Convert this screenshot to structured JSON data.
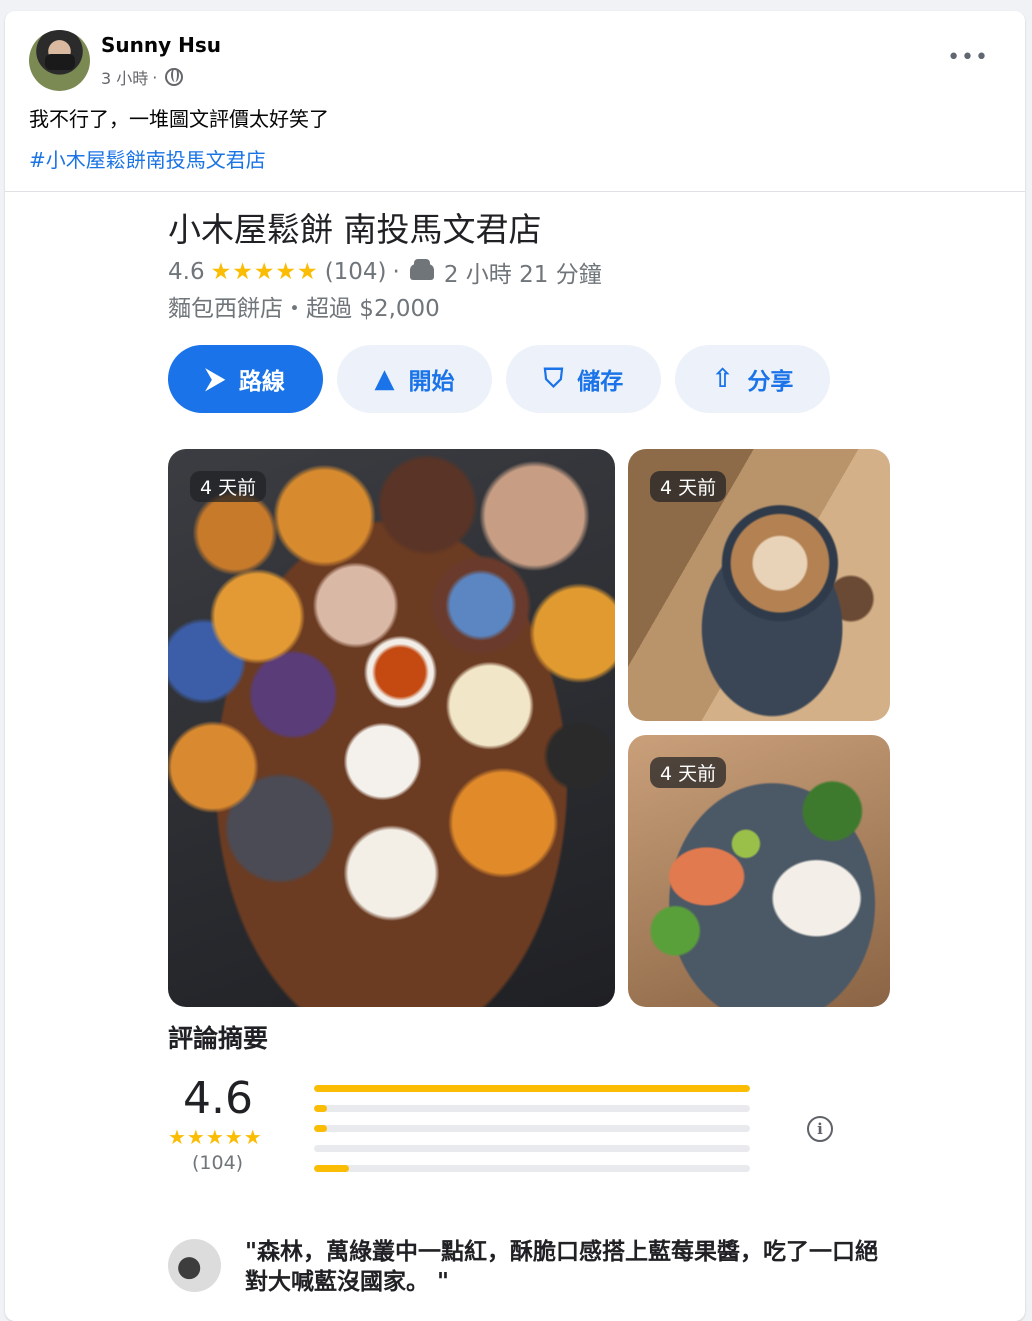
{
  "post": {
    "author": "Sunny Hsu",
    "time": "3 小時",
    "visibility_icon": "globe-icon",
    "text": "我不行了，一堆圖文評價太好笑了",
    "hashtag": "#小木屋鬆餅南投馬文君店"
  },
  "place": {
    "name": "小木屋鬆餅 南投馬文君店",
    "rating": "4.6",
    "stars": "★★★★★",
    "review_count": "(104)",
    "separator": "·",
    "drive_time": "2 小時 21 分鐘",
    "category_price": "麵包西餅店・超過 $2,000"
  },
  "buttons": [
    {
      "label": "路線",
      "icon": "directions-icon"
    },
    {
      "label": "開始",
      "icon": "navigation-arrow-icon"
    },
    {
      "label": "儲存",
      "icon": "bookmark-icon"
    },
    {
      "label": "分享",
      "icon": "share-icon"
    }
  ],
  "photos": [
    {
      "badge": "4 天前",
      "subject": "muffins"
    },
    {
      "badge": "4 天前",
      "subject": "latte"
    },
    {
      "badge": "4 天前",
      "subject": "salmon-rice"
    }
  ],
  "summary": {
    "title": "評論摘要",
    "rating": "4.6",
    "stars": "★★★★★",
    "count": "(104)",
    "distribution": [
      {
        "stars": 5,
        "fraction": 1.0
      },
      {
        "stars": 4,
        "fraction": 0.03
      },
      {
        "stars": 3,
        "fraction": 0.02
      },
      {
        "stars": 2,
        "fraction": 0.0
      },
      {
        "stars": 1,
        "fraction": 0.08
      }
    ]
  },
  "review": {
    "text": "\"森林，萬綠叢中一點紅，酥脆口感搭上藍莓果醬，吃了一口絕對大喊藍沒國家。 \""
  },
  "colors": {
    "primary": "#1a73e8",
    "star": "#fbbc04",
    "link": "#1b74e4"
  }
}
